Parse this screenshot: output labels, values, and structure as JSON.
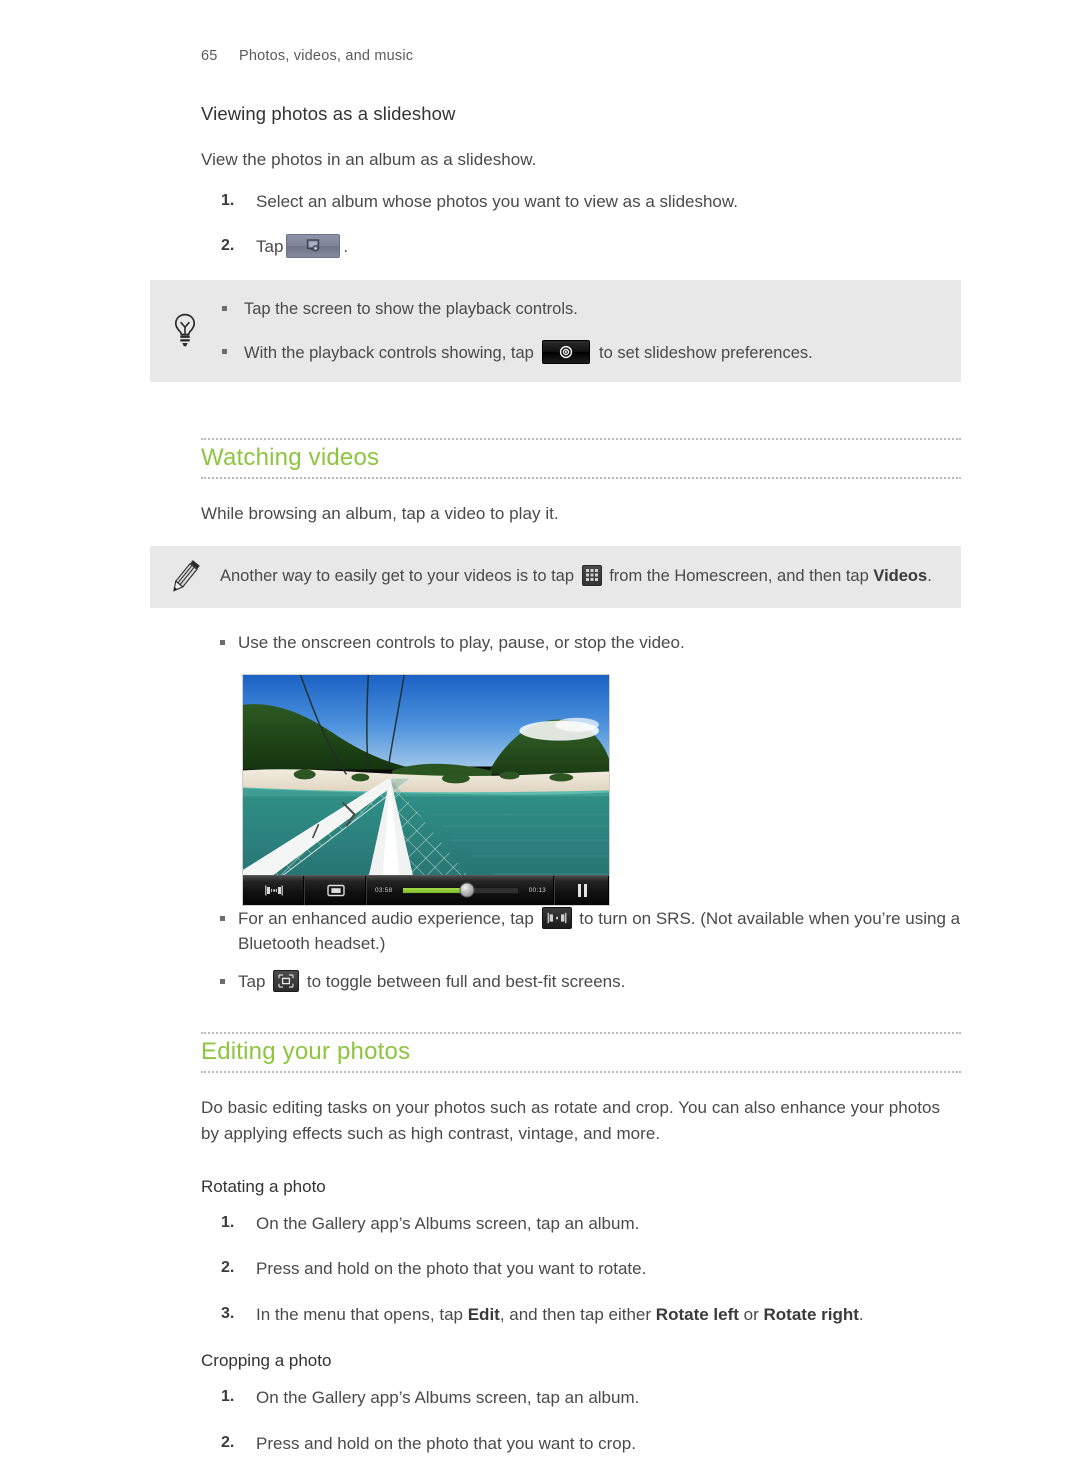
{
  "header": {
    "page_number": "65",
    "chapter": "Photos, videos, and music"
  },
  "sections": {
    "slideshow": {
      "heading": "Viewing photos as a slideshow",
      "intro": "View the photos in an album as a slideshow.",
      "step1_num": "1.",
      "step1_text": "Select an album whose photos you want to view as a slideshow.",
      "step2_num": "2.",
      "step2_text": "Tap",
      "step2_after": ".",
      "tip": {
        "icon": "lightbulb-icon",
        "bullet1": "Tap the screen to show the playback controls.",
        "bullet2_before": "With the playback controls showing, tap",
        "bullet2_after": "to set slideshow preferences."
      }
    },
    "watching_videos": {
      "heading": "Watching videos",
      "intro": "While browsing an album, tap a video to play it.",
      "note": {
        "icon": "pencil-icon",
        "text_before": "Another way to easily get to your videos is to tap",
        "text_mid": "from the Homescreen, and then tap",
        "bold_word": "Videos",
        "text_after": "."
      },
      "bullet_controls": "Use the onscreen controls to play, pause, or stop the video.",
      "video_shot": {
        "alt": "Video player showing a boat bow with safety netting over green water and a forested island",
        "elapsed_time": "03:58",
        "total_time": "00:13",
        "progress_percent": 56,
        "buttons": [
          "srs-audio-icon",
          "aspect-fit-icon",
          "pause-icon"
        ]
      },
      "bullet_srs_before": "For an enhanced audio experience, tap",
      "bullet_srs_after": "to turn on SRS. (Not available when you’re using a Bluetooth headset.)",
      "bullet_fit_before": "Tap",
      "bullet_fit_after": "to toggle between full and best-fit screens."
    },
    "editing_photos": {
      "heading": "Editing your photos",
      "intro": "Do basic editing tasks on your photos such as rotate and crop. You can also enhance your photos by applying effects such as high contrast, vintage, and more.",
      "rotating": {
        "heading": "Rotating a photo",
        "step1_num": "1.",
        "step1_text": "On the Gallery app’s Albums screen, tap an album.",
        "step2_num": "2.",
        "step2_text": "Press and hold on the photo that you want to rotate.",
        "step3_num": "3.",
        "step3_before": "In the menu that opens, tap",
        "step3_bold1": "Edit",
        "step3_mid": ", and then tap either",
        "step3_bold2": "Rotate left",
        "step3_or": "or",
        "step3_bold3": "Rotate right",
        "step3_end": "."
      },
      "cropping": {
        "heading": "Cropping a photo",
        "step1_num": "1.",
        "step1_text": "On the Gallery app’s Albums screen, tap an album.",
        "step2_num": "2.",
        "step2_text": "Press and hold on the photo that you want to crop."
      }
    }
  },
  "colors": {
    "section_heading_green": "#8cc63f",
    "callout_background": "#e8e8e8",
    "body_text": "#4a4a4a",
    "progress_green": "#8cc63f"
  }
}
